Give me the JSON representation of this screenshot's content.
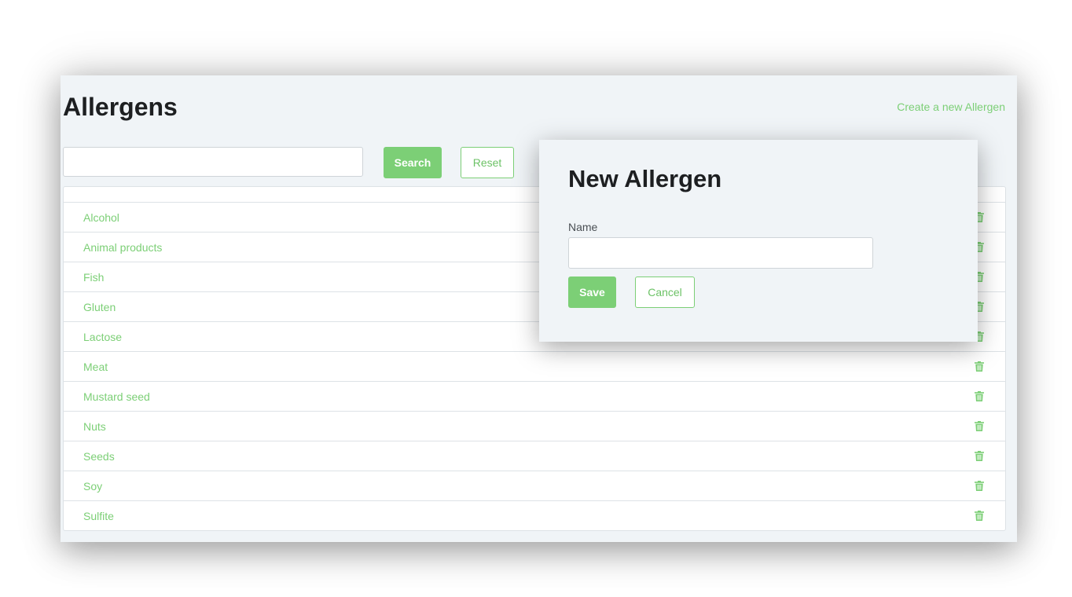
{
  "page": {
    "title": "Allergens",
    "create_link": "Create a new Allergen"
  },
  "search": {
    "value": "",
    "placeholder": "",
    "search_label": "Search",
    "reset_label": "Reset"
  },
  "allergens": [
    {
      "name": "Alcohol"
    },
    {
      "name": "Animal products"
    },
    {
      "name": "Fish"
    },
    {
      "name": "Gluten"
    },
    {
      "name": "Lactose"
    },
    {
      "name": "Meat"
    },
    {
      "name": "Mustard seed"
    },
    {
      "name": "Nuts"
    },
    {
      "name": "Seeds"
    },
    {
      "name": "Soy"
    },
    {
      "name": "Sulfite"
    }
  ],
  "row_action_icon": "trash-icon",
  "modal": {
    "title": "New Allergen",
    "name_label": "Name",
    "name_value": "",
    "save_label": "Save",
    "cancel_label": "Cancel"
  },
  "colors": {
    "accent": "#7ccf76",
    "page_background": "#f0f4f7",
    "heading": "#1d1f21"
  }
}
